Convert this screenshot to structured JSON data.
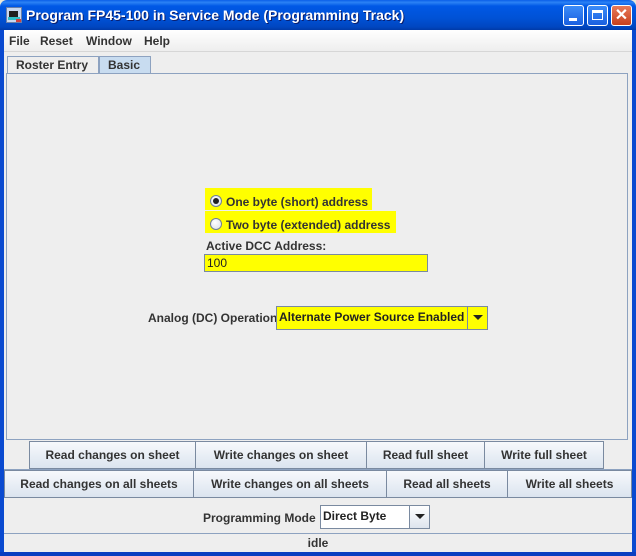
{
  "window": {
    "title": "Program FP45-100 in Service Mode (Programming Track)",
    "icon": "locomotive-icon",
    "controls": {
      "minimize": "minimize-icon",
      "maximize": "maximize-icon",
      "close": "close-icon",
      "close_glyph": "✕"
    }
  },
  "menubar": {
    "items": [
      "File",
      "Reset",
      "Window",
      "Help"
    ]
  },
  "tabs": [
    {
      "label": "Roster Entry",
      "active": false
    },
    {
      "label": "Basic",
      "active": true
    }
  ],
  "basic": {
    "address_options": [
      {
        "label": "One byte (short) address",
        "selected": true
      },
      {
        "label": "Two byte (extended) address",
        "selected": false
      }
    ],
    "active_address_label": "Active DCC Address:",
    "active_address_value": "100",
    "analog_label": "Analog (DC) Operation",
    "analog_value": "Alternate Power Source Enabled",
    "highlight_color": "#ffff00"
  },
  "sheet_buttons": [
    "Read changes on sheet",
    "Write changes on sheet",
    "Read full sheet",
    "Write full sheet"
  ],
  "all_buttons": [
    "Read changes on all sheets",
    "Write changes on all sheets",
    "Read all sheets",
    "Write all sheets"
  ],
  "programming_mode": {
    "label": "Programming Mode",
    "value": "Direct Byte"
  },
  "status": "idle"
}
